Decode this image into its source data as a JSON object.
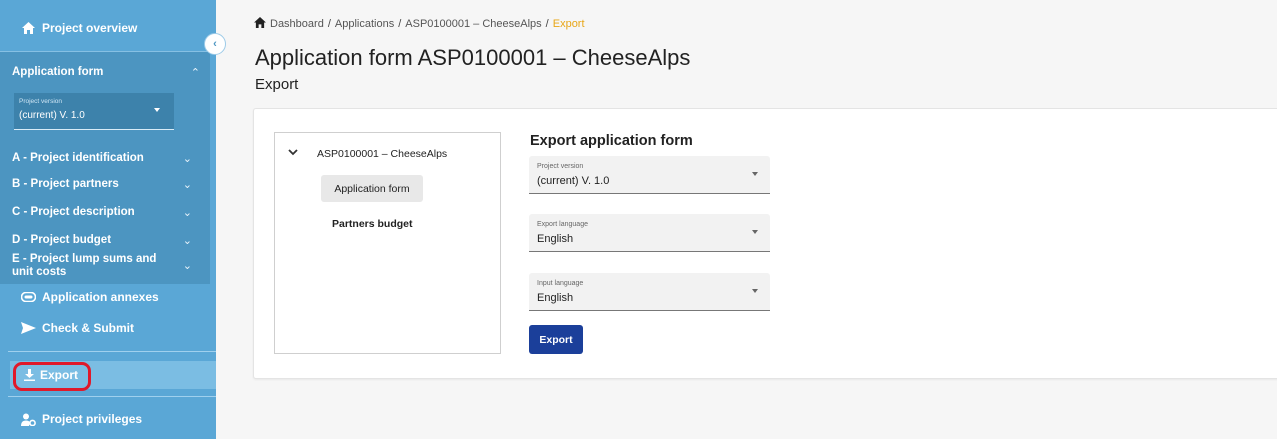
{
  "sidebar": {
    "project_overview": "Project overview",
    "application_form": "Application form",
    "project_version": {
      "label": "Project version",
      "value": "(current) V. 1.0"
    },
    "sections": [
      {
        "label": "A - Project identification"
      },
      {
        "label": "B - Project partners"
      },
      {
        "label": "C - Project description"
      },
      {
        "label": "D - Project budget"
      },
      {
        "label": "E - Project lump sums and unit costs"
      }
    ],
    "application_annexes": "Application annexes",
    "check_submit": "Check & Submit",
    "export": "Export",
    "project_privileges": "Project privileges"
  },
  "breadcrumb": {
    "items": [
      "Dashboard",
      "Applications",
      "ASP0100001 – CheeseAlps"
    ],
    "current": "Export",
    "separator": "/"
  },
  "page": {
    "title": "Application form ASP0100001 – CheeseAlps",
    "subtitle": "Export"
  },
  "tree": {
    "root": "ASP0100001 – CheeseAlps",
    "items": [
      "Application form",
      "Partners budget"
    ],
    "selected": "Application form"
  },
  "export_panel": {
    "title": "Export application form",
    "fields": [
      {
        "label": "Project version",
        "value": "(current) V. 1.0"
      },
      {
        "label": "Export language",
        "value": "English"
      },
      {
        "label": "Input language",
        "value": "English"
      }
    ],
    "button": "Export"
  },
  "colors": {
    "sidebar": "#5aa7d6",
    "sidebar_section": "#4c95c1",
    "primary_button": "#1b3f9a",
    "breadcrumb_current": "#e8a617",
    "highlight_ring": "#e0192a"
  },
  "icons": {
    "home": "home-icon",
    "annexes": "attachment-icon",
    "submit": "send-icon",
    "export": "download-icon",
    "privileges": "users-gear-icon",
    "collapse": "chevron-left-icon"
  }
}
